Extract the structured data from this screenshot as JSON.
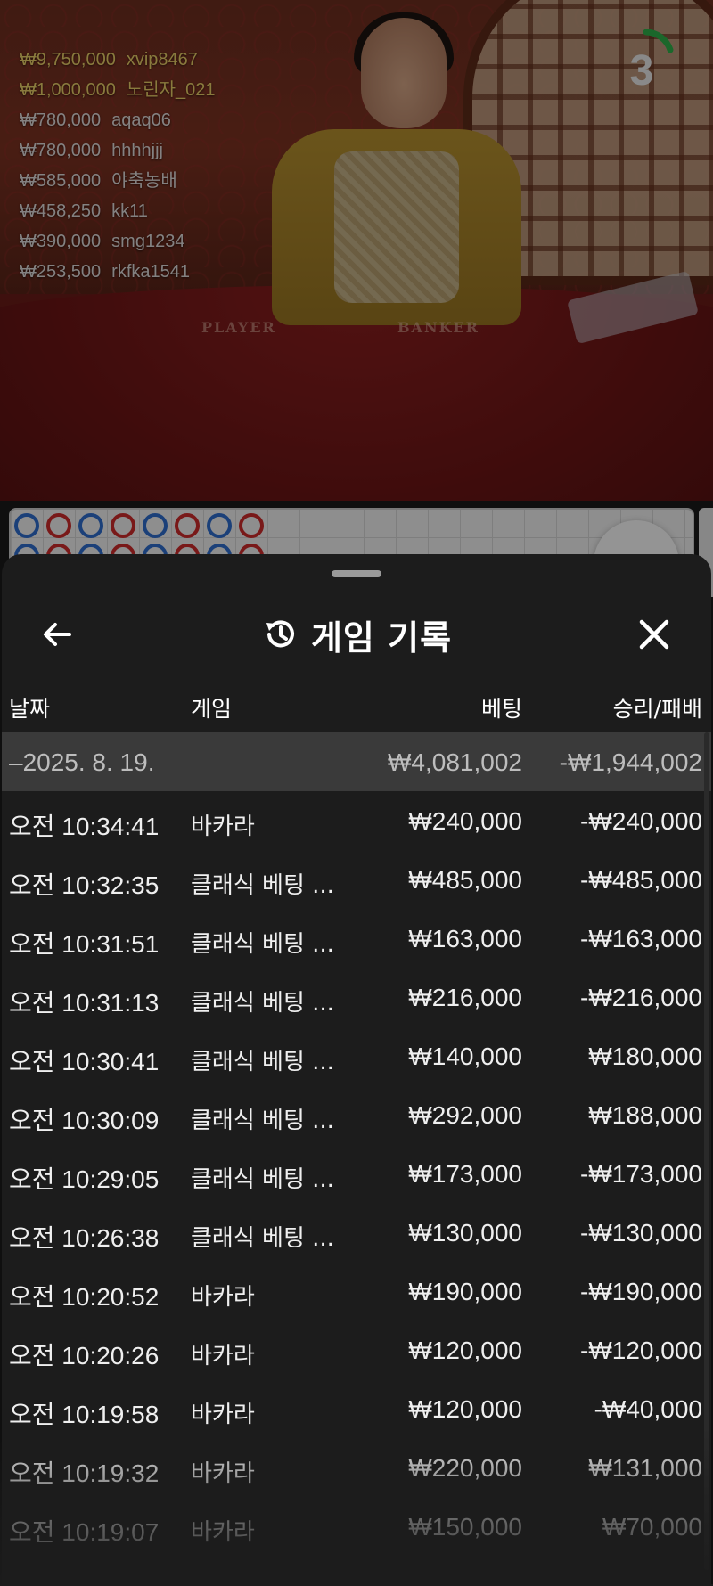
{
  "live_table": {
    "countdown": "3",
    "table_labels": [
      "PLAYER",
      "BANKER"
    ],
    "winners": [
      {
        "amount": "₩9,750,000",
        "user": "xvip8467",
        "highlight": true
      },
      {
        "amount": "₩1,000,000",
        "user": "노린자_021",
        "highlight": true
      },
      {
        "amount": "₩780,000",
        "user": "aqaq06",
        "highlight": false
      },
      {
        "amount": "₩780,000",
        "user": "hhhhjjj",
        "highlight": false
      },
      {
        "amount": "₩585,000",
        "user": "야축농배",
        "highlight": false
      },
      {
        "amount": "₩458,250",
        "user": "kk11",
        "highlight": false
      },
      {
        "amount": "₩390,000",
        "user": "smg1234",
        "highlight": false
      },
      {
        "amount": "₩253,500",
        "user": "rkfka1541",
        "highlight": false
      }
    ]
  },
  "roadmap": {
    "row1": [
      "P",
      "B",
      "P",
      "B",
      "P",
      "B",
      "P",
      "B"
    ],
    "colors": {
      "player": "#2f6fd1",
      "banker": "#d12b2b"
    }
  },
  "sheet": {
    "back_icon": "arrow-left-icon",
    "history_icon": "history-clock-icon",
    "close_icon": "close-x-icon",
    "title": "게임 기록",
    "columns": {
      "date": "날짜",
      "game": "게임",
      "bet": "베팅",
      "result": "승리/패배"
    },
    "summary": {
      "date": "–2025. 8. 19.",
      "bet": "₩4,081,002",
      "result": "-₩1,944,002"
    },
    "rows": [
      {
        "time": "오전 10:34:41",
        "game": "바카라",
        "bet": "₩240,000",
        "result": "-₩240,000"
      },
      {
        "time": "오전 10:32:35",
        "game": "클래식 베팅 ...",
        "bet": "₩485,000",
        "result": "-₩485,000"
      },
      {
        "time": "오전 10:31:51",
        "game": "클래식 베팅 ...",
        "bet": "₩163,000",
        "result": "-₩163,000"
      },
      {
        "time": "오전 10:31:13",
        "game": "클래식 베팅 ...",
        "bet": "₩216,000",
        "result": "-₩216,000"
      },
      {
        "time": "오전 10:30:41",
        "game": "클래식 베팅 ...",
        "bet": "₩140,000",
        "result": "₩180,000"
      },
      {
        "time": "오전 10:30:09",
        "game": "클래식 베팅 ...",
        "bet": "₩292,000",
        "result": "₩188,000"
      },
      {
        "time": "오전 10:29:05",
        "game": "클래식 베팅 ...",
        "bet": "₩173,000",
        "result": "-₩173,000"
      },
      {
        "time": "오전 10:26:38",
        "game": "클래식 베팅 ...",
        "bet": "₩130,000",
        "result": "-₩130,000"
      },
      {
        "time": "오전 10:20:52",
        "game": "바카라",
        "bet": "₩190,000",
        "result": "-₩190,000"
      },
      {
        "time": "오전 10:20:26",
        "game": "바카라",
        "bet": "₩120,000",
        "result": "-₩120,000"
      },
      {
        "time": "오전 10:19:58",
        "game": "바카라",
        "bet": "₩120,000",
        "result": "-₩40,000"
      },
      {
        "time": "오전 10:19:32",
        "game": "바카라",
        "bet": "₩220,000",
        "result": "₩131,000"
      },
      {
        "time": "오전 10:19:07",
        "game": "바카라",
        "bet": "₩150,000",
        "result": "₩70,000"
      }
    ]
  }
}
